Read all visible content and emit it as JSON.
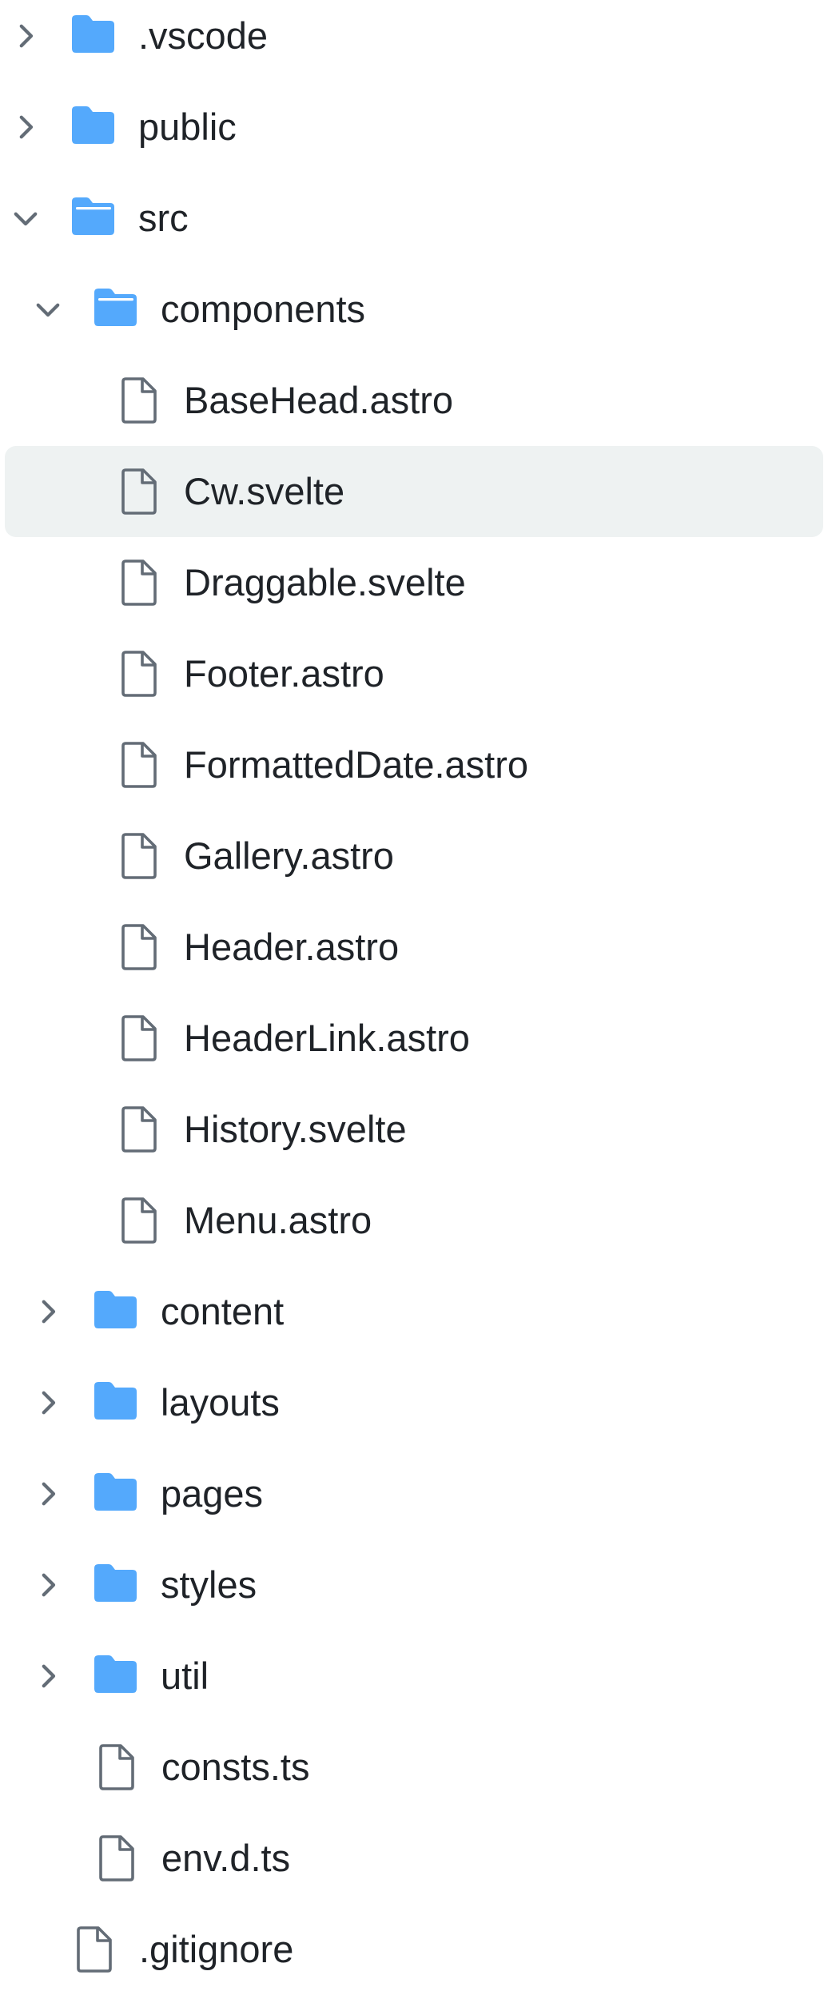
{
  "explorer": {
    "colors": {
      "folder": "#54a9fc",
      "file_outline": "#636c76",
      "chevron": "#636c76",
      "selected_bg": "#eef2f2",
      "text": "#1f2328"
    },
    "items": [
      {
        "label": ".vscode",
        "type": "folder",
        "depth": 0,
        "expanded": false,
        "selected": false
      },
      {
        "label": "public",
        "type": "folder",
        "depth": 0,
        "expanded": false,
        "selected": false
      },
      {
        "label": "src",
        "type": "folder",
        "depth": 0,
        "expanded": true,
        "selected": false
      },
      {
        "label": "components",
        "type": "folder",
        "depth": 1,
        "expanded": true,
        "selected": false
      },
      {
        "label": "BaseHead.astro",
        "type": "file",
        "depth": 2,
        "selected": false
      },
      {
        "label": "Cw.svelte",
        "type": "file",
        "depth": 2,
        "selected": true
      },
      {
        "label": "Draggable.svelte",
        "type": "file",
        "depth": 2,
        "selected": false
      },
      {
        "label": "Footer.astro",
        "type": "file",
        "depth": 2,
        "selected": false
      },
      {
        "label": "FormattedDate.astro",
        "type": "file",
        "depth": 2,
        "selected": false
      },
      {
        "label": "Gallery.astro",
        "type": "file",
        "depth": 2,
        "selected": false
      },
      {
        "label": "Header.astro",
        "type": "file",
        "depth": 2,
        "selected": false
      },
      {
        "label": "HeaderLink.astro",
        "type": "file",
        "depth": 2,
        "selected": false
      },
      {
        "label": "History.svelte",
        "type": "file",
        "depth": 2,
        "selected": false
      },
      {
        "label": "Menu.astro",
        "type": "file",
        "depth": 2,
        "selected": false
      },
      {
        "label": "content",
        "type": "folder",
        "depth": 1,
        "expanded": false,
        "selected": false
      },
      {
        "label": "layouts",
        "type": "folder",
        "depth": 1,
        "expanded": false,
        "selected": false
      },
      {
        "label": "pages",
        "type": "folder",
        "depth": 1,
        "expanded": false,
        "selected": false
      },
      {
        "label": "styles",
        "type": "folder",
        "depth": 1,
        "expanded": false,
        "selected": false
      },
      {
        "label": "util",
        "type": "folder",
        "depth": 1,
        "expanded": false,
        "selected": false
      },
      {
        "label": "consts.ts",
        "type": "file",
        "depth": 1,
        "selected": false
      },
      {
        "label": "env.d.ts",
        "type": "file",
        "depth": 1,
        "selected": false
      },
      {
        "label": ".gitignore",
        "type": "file",
        "depth": 0,
        "selected": false
      }
    ]
  }
}
